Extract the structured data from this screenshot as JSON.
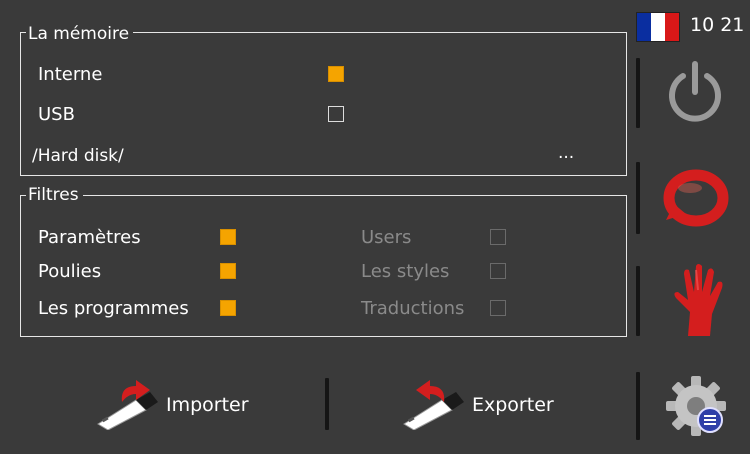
{
  "status": {
    "time": "10 21",
    "flag_colors": [
      "#0a2ea0",
      "#ffffff",
      "#d81818"
    ]
  },
  "memory": {
    "title": "La mémoire",
    "internal_label": "Interne",
    "internal_checked": true,
    "usb_label": "USB",
    "usb_checked": false,
    "path": "/Hard disk/",
    "browse_label": "..."
  },
  "filters": {
    "title": "Filtres",
    "items": [
      {
        "label": "Paramètres",
        "checked": true,
        "enabled": true
      },
      {
        "label": "Poulies",
        "checked": true,
        "enabled": true
      },
      {
        "label": "Les programmes",
        "checked": true,
        "enabled": true
      },
      {
        "label": "Users",
        "checked": false,
        "enabled": false
      },
      {
        "label": "Les styles",
        "checked": false,
        "enabled": false
      },
      {
        "label": "Traductions",
        "checked": false,
        "enabled": false
      }
    ]
  },
  "actions": {
    "import_label": "Importer",
    "export_label": "Exporter"
  },
  "side": {
    "power_icon": "power-icon",
    "refresh_icon": "refresh-icon",
    "stop_icon": "hand-stop-icon",
    "settings_icon": "settings-gear-icon"
  },
  "colors": {
    "accent": "#f5a400",
    "background": "#3a3a3a"
  }
}
